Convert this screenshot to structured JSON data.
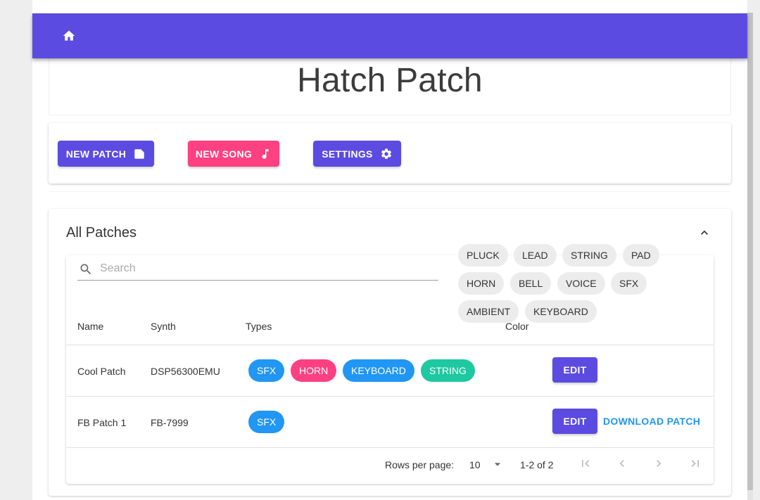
{
  "appbar": {
    "home_icon": "home-icon",
    "color": "#5b4be0"
  },
  "title": "Hatch Patch",
  "actions": [
    {
      "label": "NEW PATCH",
      "icon": "note-icon",
      "color": "#5b4be0"
    },
    {
      "label": "NEW SONG",
      "icon": "music-note-icon",
      "color": "#ff4081"
    },
    {
      "label": "SETTINGS",
      "icon": "gear-icon",
      "color": "#5b4be0"
    }
  ],
  "patches": {
    "heading": "All Patches",
    "collapse_icon": "chevron-up-icon",
    "search": {
      "placeholder": "Search",
      "value": ""
    },
    "type_filters": [
      "PLUCK",
      "LEAD",
      "STRING",
      "PAD",
      "HORN",
      "BELL",
      "VOICE",
      "SFX",
      "AMBIENT",
      "KEYBOARD"
    ],
    "columns": [
      "Name",
      "Synth",
      "Types",
      "Color"
    ],
    "rows": [
      {
        "name": "Cool Patch",
        "synth": "DSP56300EMU",
        "types": [
          {
            "label": "SFX",
            "color": "#2196f3"
          },
          {
            "label": "HORN",
            "color": "#ff4081"
          },
          {
            "label": "KEYBOARD",
            "color": "#2196f3"
          },
          {
            "label": "STRING",
            "color": "#1ec8a0"
          }
        ],
        "edit_label": "EDIT",
        "download_label": ""
      },
      {
        "name": "FB Patch 1",
        "synth": "FB-7999",
        "types": [
          {
            "label": "SFX",
            "color": "#2196f3"
          }
        ],
        "edit_label": "EDIT",
        "download_label": "DOWNLOAD PATCH"
      }
    ],
    "pagination": {
      "rows_per_page_label": "Rows per page:",
      "rows_per_page": "10",
      "range": "1-2 of 2"
    }
  }
}
